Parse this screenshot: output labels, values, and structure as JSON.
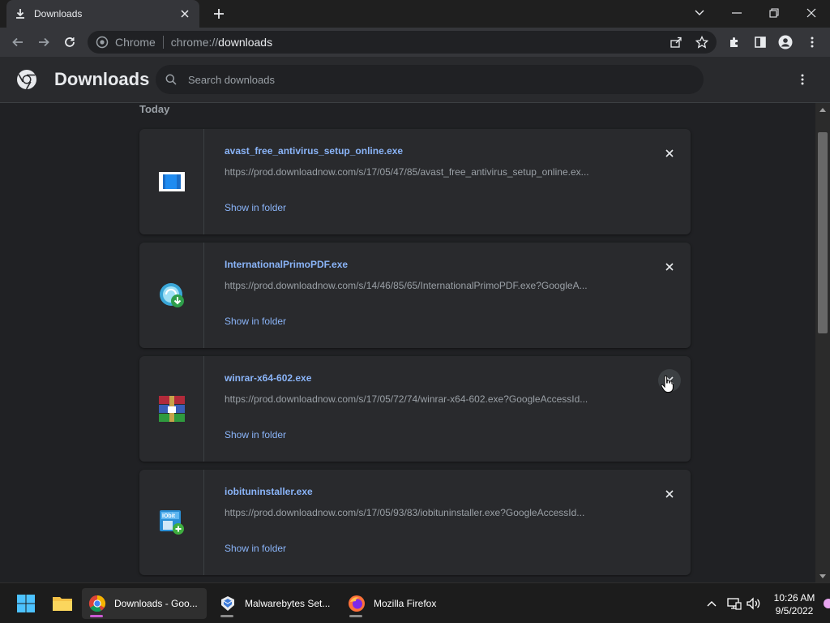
{
  "browser": {
    "tab_title": "Downloads",
    "omnibox_origin_label": "Chrome",
    "omnibox_url_prefix": "chrome://",
    "omnibox_url_path": "downloads"
  },
  "page": {
    "title": "Downloads",
    "search_placeholder": "Search downloads",
    "section_date": "Today"
  },
  "downloads": [
    {
      "name": "avast_free_antivirus_setup_online.exe",
      "url": "https://prod.downloadnow.com/s/17/05/47/85/avast_free_antivirus_setup_online.ex...",
      "action": "Show in folder",
      "icon": "avast-installer-icon"
    },
    {
      "name": "InternationalPrimoPDF.exe",
      "url": "https://prod.downloadnow.com/s/14/46/85/65/InternationalPrimoPDF.exe?GoogleA...",
      "action": "Show in folder",
      "icon": "primopdf-installer-icon"
    },
    {
      "name": "winrar-x64-602.exe",
      "url": "https://prod.downloadnow.com/s/17/05/72/74/winrar-x64-602.exe?GoogleAccessId...",
      "action": "Show in folder",
      "icon": "winrar-icon"
    },
    {
      "name": "iobituninstaller.exe",
      "url": "https://prod.downloadnow.com/s/17/05/93/83/iobituninstaller.exe?GoogleAccessId...",
      "action": "Show in folder",
      "icon": "iobit-icon"
    }
  ],
  "taskbar": {
    "apps": [
      {
        "label": "Downloads - Goo...",
        "icon": "chrome-icon",
        "active": true
      },
      {
        "label": "Malwarebytes Set...",
        "icon": "malwarebytes-icon",
        "active": false
      },
      {
        "label": "Mozilla Firefox",
        "icon": "firefox-icon",
        "active": false
      }
    ],
    "time": "10:26 AM",
    "date": "9/5/2022"
  },
  "colors": {
    "accent_link": "#8ab4f8",
    "background": "#202124",
    "card": "#292a2d",
    "taskbar_active_indicator": "#c95ad3"
  }
}
